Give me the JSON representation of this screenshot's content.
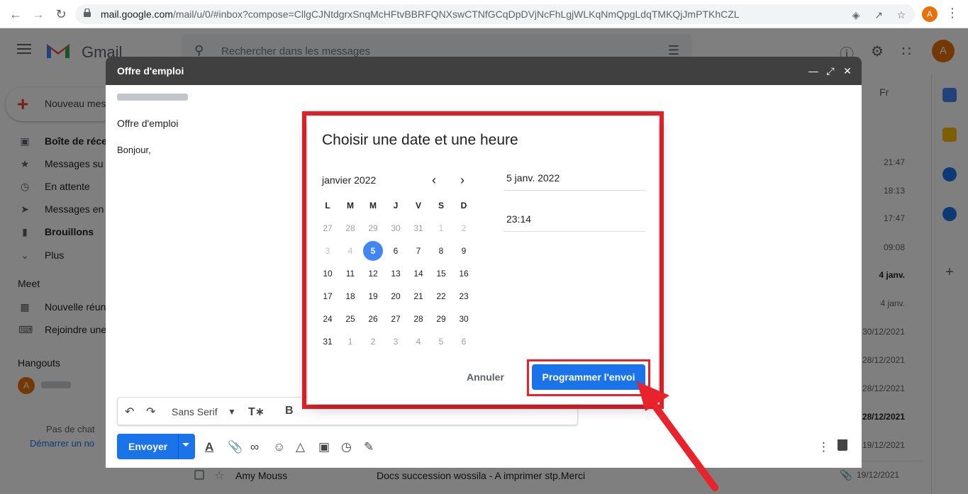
{
  "browser": {
    "url_host": "mail.google.com",
    "url_path": "/mail/u/0/#inbox?compose=CllgCJNtdgrxSnqMcHFtvBBRFQNXswCTNfGCqDpDVjNcFhLgjWLKqNmQpgLdqTMKQjJmPTKhCZL",
    "profile_initial": "A"
  },
  "gmail": {
    "app_name": "Gmail",
    "search_placeholder": "Rechercher dans les messages",
    "avatar_initial": "A",
    "compose_label": "Nouveau mes",
    "nav": [
      {
        "label": "Boîte de réce",
        "bold": true,
        "icon": "inbox-icon"
      },
      {
        "label": "Messages su",
        "bold": false,
        "icon": "star-icon"
      },
      {
        "label": "En attente",
        "bold": false,
        "icon": "clock-icon"
      },
      {
        "label": "Messages en",
        "bold": false,
        "icon": "send-icon"
      },
      {
        "label": "Brouillons",
        "bold": true,
        "icon": "draft-icon"
      },
      {
        "label": "Plus",
        "bold": false,
        "icon": "chevron-down-icon"
      }
    ],
    "meet_title": "Meet",
    "meet_items": [
      {
        "label": "Nouvelle réun",
        "icon": "video-icon"
      },
      {
        "label": "Rejoindre une",
        "icon": "keyboard-icon"
      }
    ],
    "hangouts_title": "Hangouts",
    "hangout_initial": "A",
    "no_chat": "Pas de chat",
    "start_chat": "Démarrer un no",
    "lang_label": "Fr",
    "dates": [
      {
        "text": "21:47",
        "bold": false
      },
      {
        "text": "18:13",
        "bold": false
      },
      {
        "text": "17:47",
        "bold": false
      },
      {
        "text": "09:08",
        "bold": false
      },
      {
        "text": "4 janv.",
        "bold": true
      },
      {
        "text": "4 janv.",
        "bold": false
      },
      {
        "text": "30/12/2021",
        "bold": false
      },
      {
        "text": "28/12/2021",
        "bold": false
      },
      {
        "text": "28/12/2021",
        "bold": false
      },
      {
        "text": "28/12/2021",
        "bold": true
      },
      {
        "text": "19/12/2021",
        "bold": false
      },
      {
        "text": "19/12/2021",
        "bold": false
      }
    ],
    "last_row": {
      "sender": "Amy Mouss",
      "subject": "Docs succession wossila - A imprimer stp.Merci",
      "date": "19/12/2021"
    }
  },
  "compose": {
    "title": "Offre d'emploi",
    "subject": "Offre d'emploi",
    "body": "Bonjour,",
    "font": "Sans Serif",
    "send_label": "Envoyer"
  },
  "dialog": {
    "title": "Choisir une date et une heure",
    "month": "janvier 2022",
    "weekdays": [
      "L",
      "M",
      "M",
      "J",
      "V",
      "S",
      "D"
    ],
    "weeks": [
      [
        "27",
        "28",
        "29",
        "30",
        "31",
        "1",
        "2"
      ],
      [
        "3",
        "4",
        "5",
        "6",
        "7",
        "8",
        "9"
      ],
      [
        "10",
        "11",
        "12",
        "13",
        "14",
        "15",
        "16"
      ],
      [
        "17",
        "18",
        "19",
        "20",
        "21",
        "22",
        "23"
      ],
      [
        "24",
        "25",
        "26",
        "27",
        "28",
        "29",
        "30"
      ],
      [
        "31",
        "1",
        "2",
        "3",
        "4",
        "5",
        "6"
      ]
    ],
    "selected_day": "5",
    "date_value": "5 janv. 2022",
    "time_value": "23:14",
    "cancel_label": "Annuler",
    "schedule_label": "Programmer l'envoi"
  },
  "colors": {
    "accent_blue": "#1a73e8",
    "selected_day_blue": "#4285f4",
    "highlight_red": "#e8232c",
    "avatar_orange": "#e8710a"
  }
}
